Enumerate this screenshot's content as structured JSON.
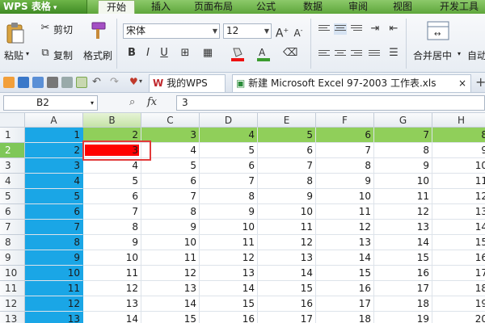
{
  "app": {
    "name": "WPS 表格",
    "caret": "▾"
  },
  "menu": {
    "tabs": [
      {
        "label": "开始",
        "active": true
      },
      {
        "label": "插入",
        "active": false
      },
      {
        "label": "页面布局",
        "active": false
      },
      {
        "label": "公式",
        "active": false
      },
      {
        "label": "数据",
        "active": false
      },
      {
        "label": "审阅",
        "active": false
      },
      {
        "label": "视图",
        "active": false
      },
      {
        "label": "开发工具",
        "active": false
      }
    ]
  },
  "ribbon": {
    "paste": "粘贴",
    "cut": "剪切",
    "copy": "复制",
    "format_painter": "格式刷",
    "font_name": "宋体",
    "font_size": "12",
    "bold": "B",
    "italic": "I",
    "underline": "U",
    "grow_font": "A",
    "shrink_font": "A",
    "merge_center": "合并居中",
    "auto_wrap": "自动"
  },
  "doc_tabs": [
    {
      "label": "我的WPS"
    },
    {
      "label": "新建 Microsoft Excel 97-2003 工作表.xls"
    }
  ],
  "doc_tab_close": "×",
  "doc_tab_add": "+",
  "formula_bar": {
    "name_box": "B2",
    "fx_label": "fx",
    "zoom_icon": "search-icon",
    "value": "3"
  },
  "grid": {
    "columns": [
      "A",
      "B",
      "C",
      "D",
      "E",
      "F",
      "G",
      "H"
    ],
    "selected_column": "B",
    "rows": [
      {
        "num": "1",
        "cells": [
          "1",
          "2",
          "3",
          "4",
          "5",
          "6",
          "7",
          "8"
        ]
      },
      {
        "num": "2",
        "cells": [
          "2",
          "3",
          "4",
          "5",
          "6",
          "7",
          "8",
          "9"
        ]
      },
      {
        "num": "3",
        "cells": [
          "3",
          "4",
          "5",
          "6",
          "7",
          "8",
          "9",
          "10"
        ]
      },
      {
        "num": "4",
        "cells": [
          "4",
          "5",
          "6",
          "7",
          "8",
          "9",
          "10",
          "11"
        ]
      },
      {
        "num": "5",
        "cells": [
          "5",
          "6",
          "7",
          "8",
          "9",
          "10",
          "11",
          "12"
        ]
      },
      {
        "num": "6",
        "cells": [
          "6",
          "7",
          "8",
          "9",
          "10",
          "11",
          "12",
          "13"
        ]
      },
      {
        "num": "7",
        "cells": [
          "7",
          "8",
          "9",
          "10",
          "11",
          "12",
          "13",
          "14"
        ]
      },
      {
        "num": "8",
        "cells": [
          "8",
          "9",
          "10",
          "11",
          "12",
          "13",
          "14",
          "15"
        ]
      },
      {
        "num": "9",
        "cells": [
          "9",
          "10",
          "11",
          "12",
          "13",
          "14",
          "15",
          "16"
        ]
      },
      {
        "num": "10",
        "cells": [
          "10",
          "11",
          "12",
          "13",
          "14",
          "15",
          "16",
          "17"
        ]
      },
      {
        "num": "11",
        "cells": [
          "11",
          "12",
          "13",
          "14",
          "15",
          "16",
          "17",
          "18"
        ]
      },
      {
        "num": "12",
        "cells": [
          "12",
          "13",
          "14",
          "15",
          "16",
          "17",
          "18",
          "19"
        ]
      },
      {
        "num": "13",
        "cells": [
          "13",
          "14",
          "15",
          "16",
          "17",
          "18",
          "19",
          "20"
        ]
      }
    ],
    "selected_row": "2",
    "active_cell": "B2"
  },
  "colors": {
    "column_a_fill": "#1aa6e6",
    "row_1_fill": "#90cf5a",
    "active_cell_fill": "#ff0000",
    "selection_border": "#e23a3a",
    "menu_green": "#5ea63b"
  }
}
